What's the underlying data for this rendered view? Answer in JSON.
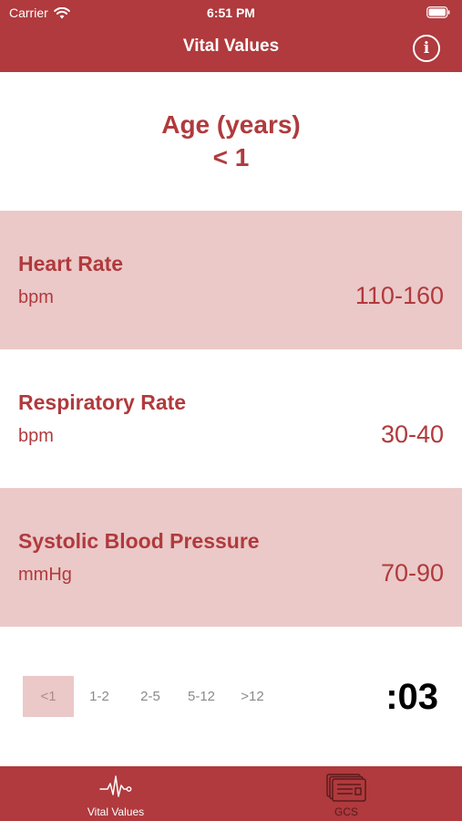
{
  "status_bar": {
    "carrier": "Carrier",
    "time": "6:51 PM"
  },
  "nav": {
    "title": "Vital Values",
    "info_glyph": "i"
  },
  "age": {
    "label": "Age (years)",
    "value": "< 1"
  },
  "vitals": [
    {
      "name": "Heart Rate",
      "unit": "bpm",
      "range": "110-160"
    },
    {
      "name": "Respiratory Rate",
      "unit": "bpm",
      "range": "30-40"
    },
    {
      "name": "Systolic Blood Pressure",
      "unit": "mmHg",
      "range": "70-90"
    }
  ],
  "age_selector": {
    "options": [
      "<1",
      "1-2",
      "2-5",
      "5-12",
      ">12"
    ],
    "selected": "<1"
  },
  "timer": ":03",
  "tabs": [
    {
      "label": "Vital Values",
      "icon": "heartbeat-icon",
      "active": true
    },
    {
      "label": "GCS",
      "icon": "documents-icon",
      "active": false
    }
  ],
  "colors": {
    "primary": "#b03a3d",
    "row_shade": "#ebc9c8",
    "inactive_tab": "#5a1b1c"
  }
}
